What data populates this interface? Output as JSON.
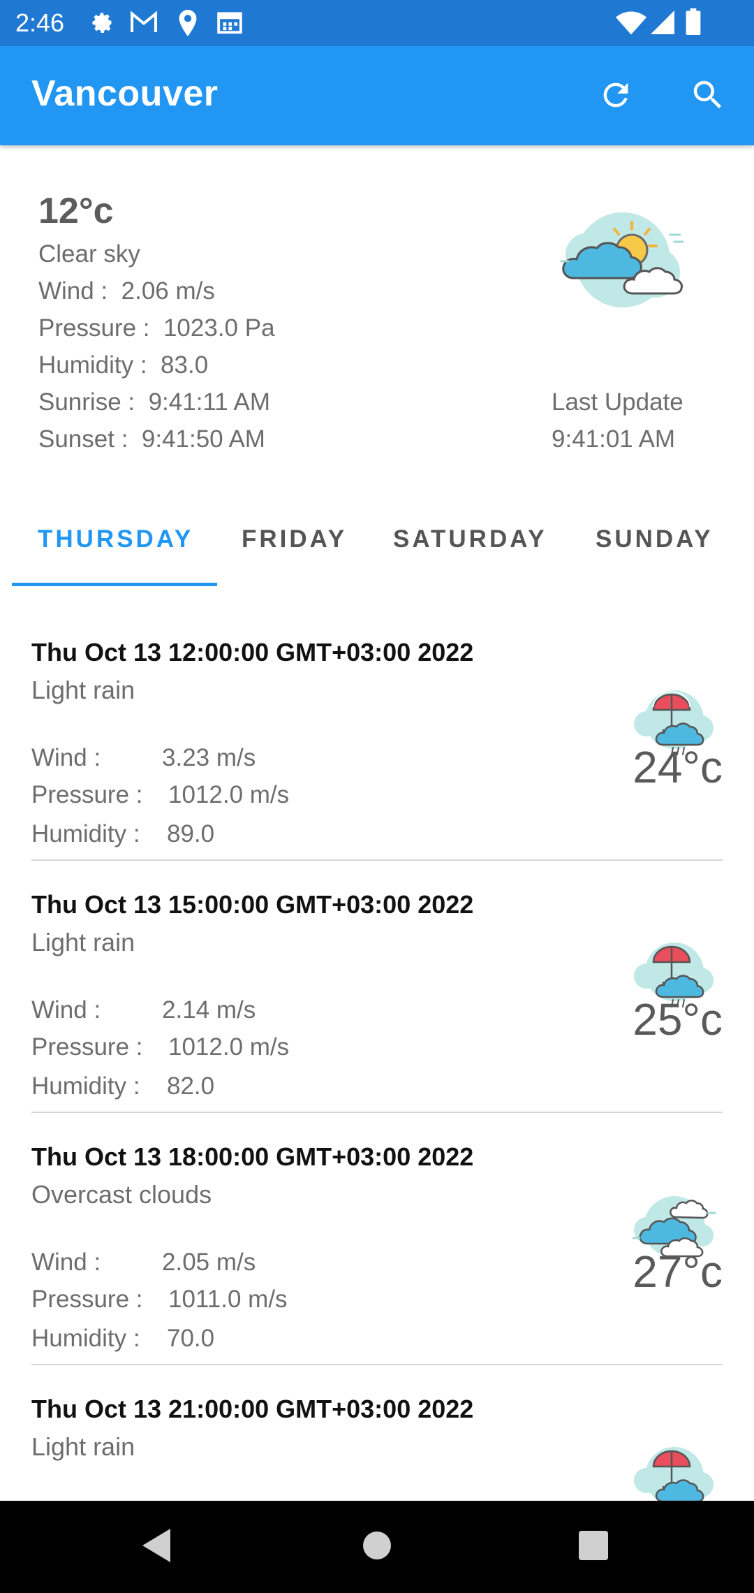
{
  "status_bar": {
    "time": "2:46",
    "icons": [
      "settings-icon",
      "gmail-icon",
      "location-icon",
      "calendar-icon",
      "wifi-icon",
      "signal-icon",
      "battery-icon"
    ]
  },
  "app_bar": {
    "title": "Vancouver",
    "refresh_icon": "refresh-icon",
    "search_icon": "search-icon",
    "color": "#2196f3"
  },
  "current": {
    "temperature": "12°c",
    "description": "Clear sky",
    "wind_label": "Wind :  ",
    "wind": "2.06 m/s",
    "pressure_label": "Pressure :  ",
    "pressure": "1023.0 Pa",
    "humidity_label": "Humidity :  ",
    "humidity": "83.0",
    "sunrise_label": "Sunrise :  ",
    "sunrise": "9:41:11 AM",
    "sunset_label": "Sunset :  ",
    "sunset": "9:41:50 AM",
    "last_update_label": "Last Update",
    "last_update": "9:41:01 AM",
    "icon": "partly-cloudy-sun-icon"
  },
  "tabs": [
    {
      "label": "THURSDAY",
      "selected": true
    },
    {
      "label": "FRIDAY",
      "selected": false
    },
    {
      "label": "SATURDAY",
      "selected": false
    },
    {
      "label": "SUNDAY",
      "selected": false
    }
  ],
  "forecast": [
    {
      "datetime": "Thu Oct 13 12:00:00 GMT+03:00 2022",
      "description": "Light rain",
      "wind_label": "Wind :",
      "wind": "3.23 m/s",
      "pressure_label": "Pressure :",
      "pressure": "1012.0 m/s",
      "humidity_label": "Humidity :",
      "humidity": "89.0",
      "temperature": "24°c",
      "icon": "rain-umbrella-icon"
    },
    {
      "datetime": "Thu Oct 13 15:00:00 GMT+03:00 2022",
      "description": "Light rain",
      "wind_label": "Wind :",
      "wind": "2.14 m/s",
      "pressure_label": "Pressure :",
      "pressure": "1012.0 m/s",
      "humidity_label": "Humidity :",
      "humidity": "82.0",
      "temperature": "25°c",
      "icon": "rain-umbrella-icon"
    },
    {
      "datetime": "Thu Oct 13 18:00:00 GMT+03:00 2022",
      "description": "Overcast clouds",
      "wind_label": "Wind :",
      "wind": "2.05 m/s",
      "pressure_label": "Pressure :",
      "pressure": "1011.0 m/s",
      "humidity_label": "Humidity :",
      "humidity": "70.0",
      "temperature": "27°c",
      "icon": "overcast-clouds-icon"
    },
    {
      "datetime": "Thu Oct 13 21:00:00 GMT+03:00 2022",
      "description": "Light rain",
      "icon": "rain-umbrella-icon"
    }
  ],
  "nav_bar": {
    "back_icon": "back-icon",
    "home_icon": "home-icon",
    "recents_icon": "recents-icon"
  }
}
